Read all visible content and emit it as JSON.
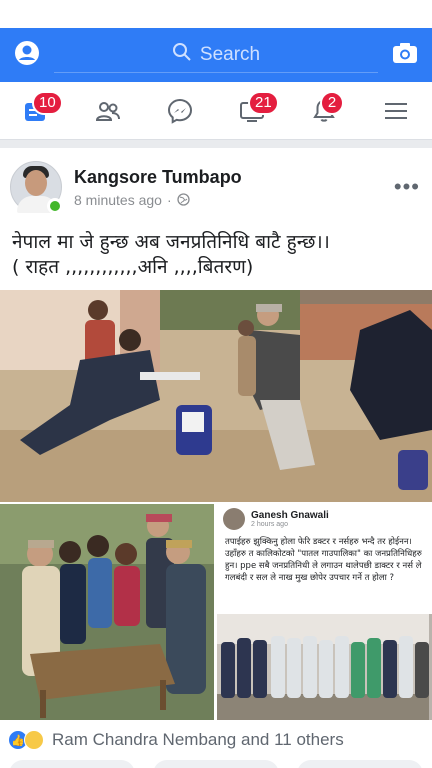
{
  "search": {
    "placeholder": "Search"
  },
  "nav": {
    "badges": {
      "news": "10",
      "watch": "21",
      "notifications": "2"
    }
  },
  "post": {
    "author": "Kangsore Tumbapo",
    "time": "8 minutes ago",
    "text_line1": "नेपाल मा जे हुन्छ अब जनप्रतिनिधि बाटै हुन्छ।।",
    "text_line2": "( राहत ,,,,,,,,,,,,अनि ,,,,बितरण)"
  },
  "shared_post": {
    "author": "Ganesh Gnawali",
    "time": "2 hours ago",
    "text": "तपाईहरु झुक्किनु होला फेरि डक्टर र नर्सहरु भन्दै तर होईनन। उहाँहरु त कालिकोटको \"पातल गाउपालिका\" का जनप्रतिनिधिहरु हुन। ppe सबै जनप्रतिनिधी ले लगाउन थालेपछी डाक्टर र नर्स ले गलबंदी र सल ले नाख मुख छोपेर उपचार गर्ने त होला ?"
  },
  "reactions": {
    "text": "Ram Chandra Nembang and 11 others"
  },
  "colors": {
    "brand": "#2f7cf6",
    "badge": "#e41e3f",
    "online": "#42b72a"
  }
}
